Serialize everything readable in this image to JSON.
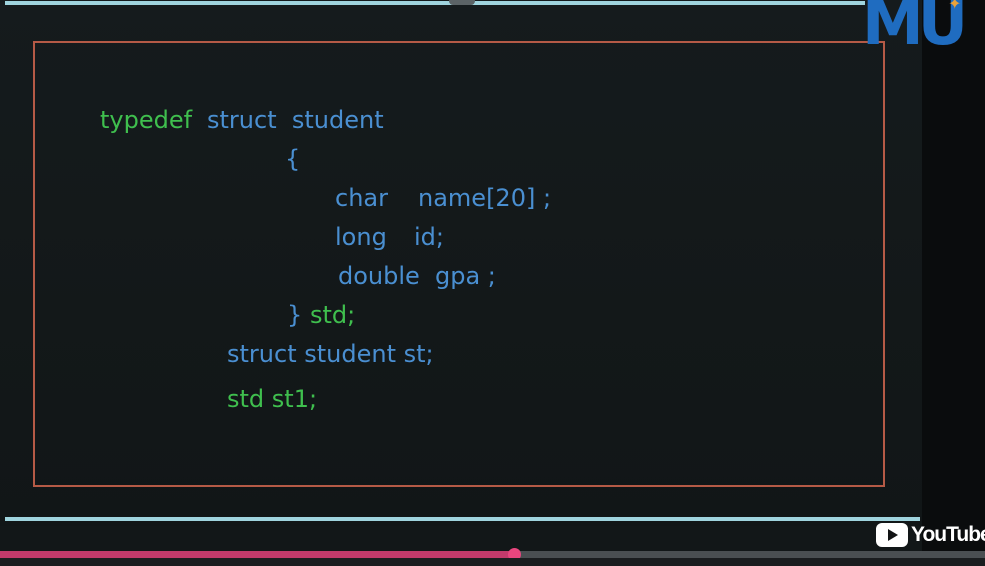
{
  "code": {
    "line1_kw": "typedef",
    "line1_rest": "struct  student",
    "line2": "{",
    "line3_type": "char",
    "line3_name": "name[20] ;",
    "line4_type": "long",
    "line4_name": "id;",
    "line5_type": "double",
    "line5_name": "gpa ;",
    "line6_brace": "}",
    "line6_alias": "std;",
    "line7": "struct student st;",
    "line8": "std st1;"
  },
  "logo": {
    "text": "MU",
    "color": "#1f6cc0"
  },
  "youtube": {
    "label": "YouTube",
    "icon": "youtube-play-icon"
  },
  "player": {
    "progress_percent": 52.3
  },
  "colors": {
    "keyword_green": "#3fbf4e",
    "keyword_blue": "#4a8fd1",
    "frame_border": "#b55a46",
    "rule": "#9fd4de",
    "progress": "#c23a6b"
  }
}
